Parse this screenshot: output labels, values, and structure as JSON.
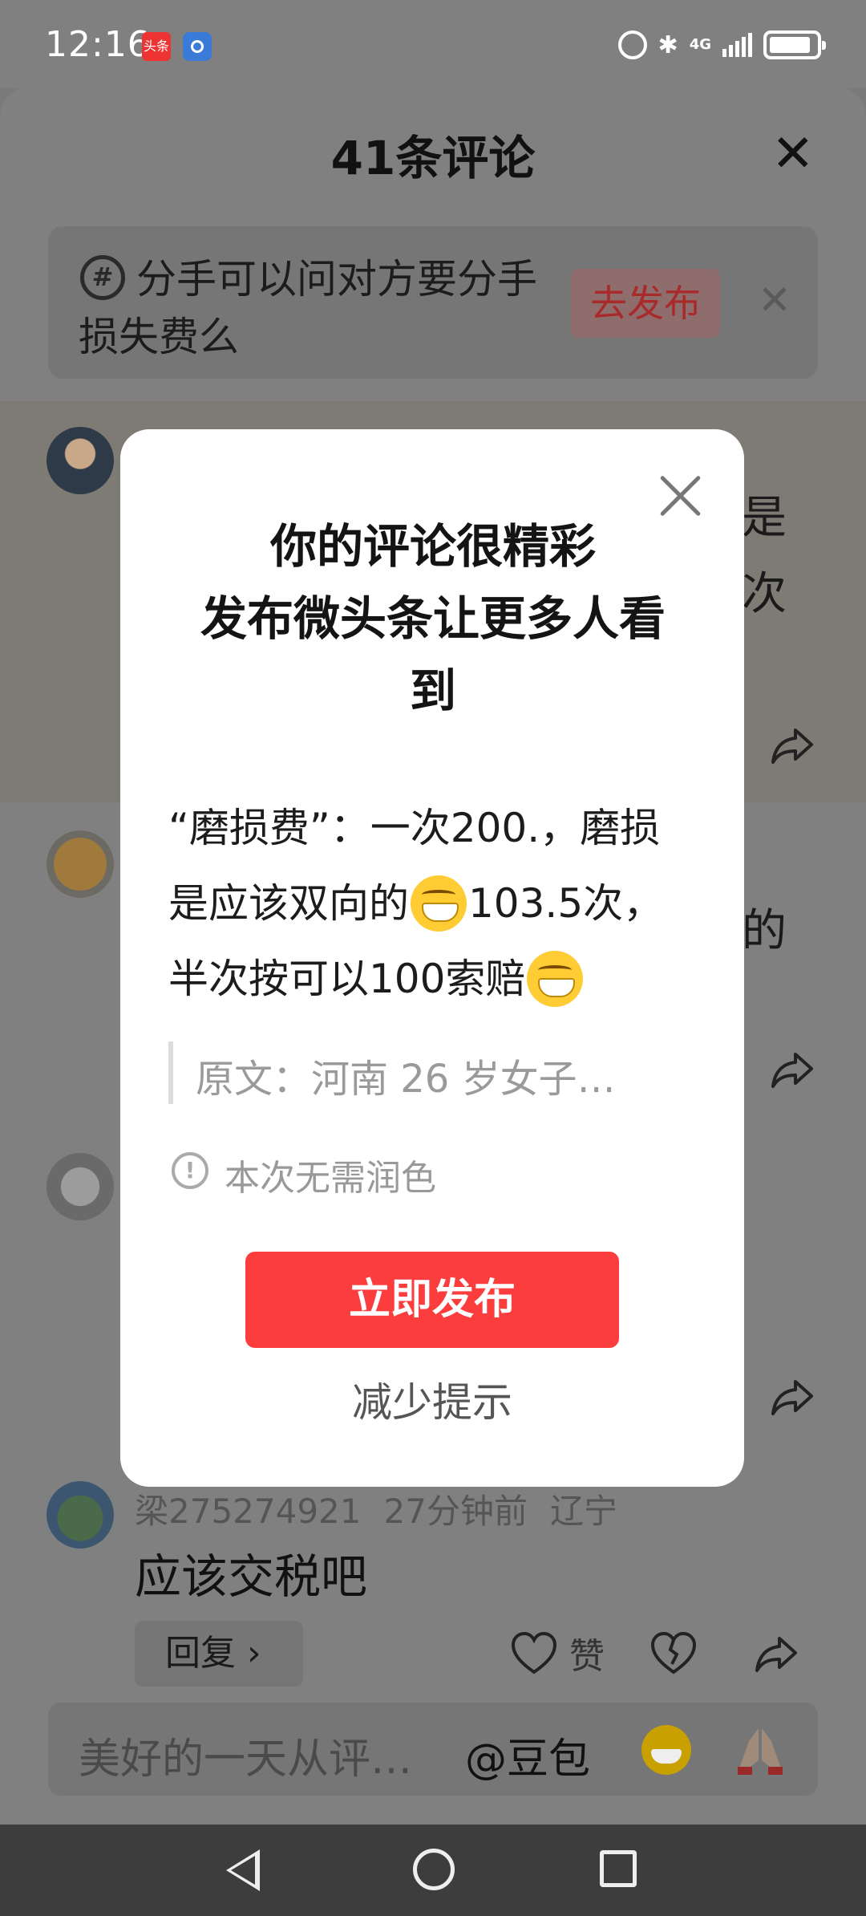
{
  "status_bar": {
    "time": "12:16",
    "app1_label": "头条",
    "network": "4G",
    "signal_bars": 5,
    "battery_level": 0.75
  },
  "sheet": {
    "title": "41条评论",
    "close_icon": "close-icon",
    "topic": {
      "text": "分手可以问对方要分手损失费么",
      "action_label": "去发布"
    },
    "peek_texts": [
      "是",
      "次",
      "的"
    ],
    "comment": {
      "username": "梁275274921",
      "time": "27分钟前",
      "location": "辽宁",
      "text": "应该交税吧",
      "reply_label": "回复 ›",
      "like_label": "赞"
    },
    "input": {
      "placeholder": "美好的一天从评…",
      "mention": "@豆包"
    }
  },
  "dialog": {
    "title_lines": [
      "你的评论很精彩",
      "发布微头条让更多人看",
      "到"
    ],
    "body_line1": "“磨损费”：一次200.，磨损",
    "body_line2": "是应该双向的",
    "body_line2b": "103.5次，",
    "body_line3": "半次按可以100索赔",
    "quote": "原文：河南 26 岁女子…",
    "info": "本次无需润色",
    "primary_label": "立即发布",
    "secondary_label": "减少提示"
  },
  "colors": {
    "primary": "#fb3d3d",
    "overlay": "#7a7a7a",
    "dialog_bg": "#ffffff"
  }
}
